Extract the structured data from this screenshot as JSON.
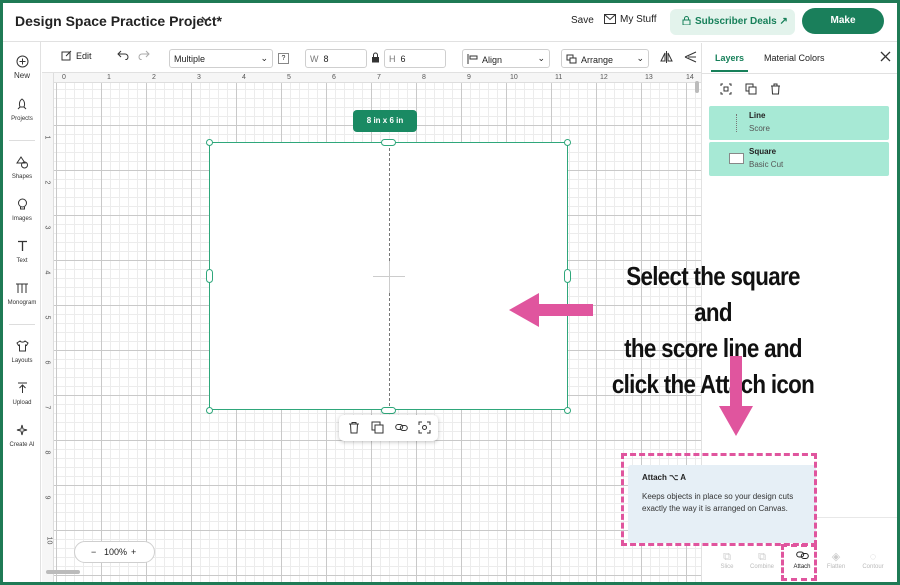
{
  "header": {
    "project_title": "Design Space Practice Project*",
    "save_label": "Save",
    "my_stuff_label": "My Stuff",
    "subscriber_deals_label": "Subscriber Deals ↗",
    "make_label": "Make"
  },
  "sidebar": {
    "new_label": "New",
    "items": [
      {
        "label": "Projects"
      },
      {
        "label": "Shapes"
      },
      {
        "label": "Images"
      },
      {
        "label": "Text"
      },
      {
        "label": "Monogram"
      },
      {
        "label": "Layouts"
      },
      {
        "label": "Upload"
      },
      {
        "label": "Create AI"
      }
    ]
  },
  "toolbar": {
    "edit_label": "Edit",
    "operation_select": "Multiple",
    "help_badge": "?",
    "width_label": "W",
    "width_value": "8",
    "height_label": "H",
    "height_value": "6",
    "align_label": "Align",
    "arrange_label": "Arrange"
  },
  "canvas": {
    "ruler_top": [
      "0",
      "1",
      "2",
      "3",
      "4",
      "5",
      "6",
      "7",
      "8",
      "9",
      "10",
      "11",
      "12",
      "13",
      "14"
    ],
    "ruler_left": [
      "1",
      "2",
      "3",
      "4",
      "5",
      "6",
      "7",
      "8",
      "9",
      "10"
    ],
    "size_tag": "8 in x 6 in",
    "zoom_minus": "−",
    "zoom_value": "100%",
    "zoom_plus": "+"
  },
  "annotation": {
    "line1": "Select the square and",
    "line2": "the score line and",
    "line3": "click the Attach icon"
  },
  "panel": {
    "tab_layers": "Layers",
    "tab_material_colors": "Material Colors",
    "layers": [
      {
        "name": "Line",
        "type": "Score"
      },
      {
        "name": "Square",
        "type": "Basic Cut"
      }
    ],
    "bottom_actions": [
      {
        "label": "Slice"
      },
      {
        "label": "Combine"
      },
      {
        "label": "Attach"
      },
      {
        "label": "Flatten"
      },
      {
        "label": "Contour"
      }
    ]
  },
  "tooltip": {
    "title": "Attach ⌥ A",
    "description": "Keeps objects in place so your design cuts exactly the way it is arranged on Canvas."
  },
  "colors": {
    "brand_green": "#1a7f5b",
    "selection": "#2fa77b",
    "layer_highlight": "#a7e9d5",
    "annotation_pink": "#e0559e"
  }
}
